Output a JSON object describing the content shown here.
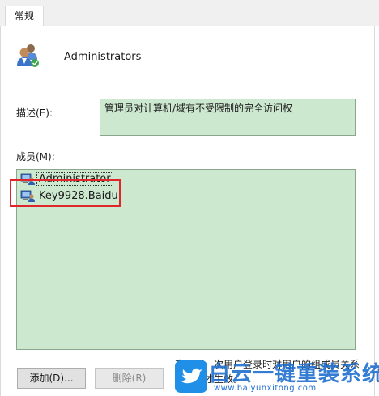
{
  "tabs": [
    {
      "label": "常规",
      "active": true
    }
  ],
  "group": {
    "name": "Administrators",
    "icon": "users-group-icon"
  },
  "description": {
    "label": "描述(E):",
    "value": "管理员对计算机/域有不受限制的完全访问权"
  },
  "members": {
    "label": "成员(M):",
    "items": [
      {
        "name": "Administrator",
        "icon": "user-icon"
      },
      {
        "name": "Key9928.Baidu",
        "icon": "user-icon"
      }
    ]
  },
  "buttons": {
    "add_label": "添加(D)...",
    "remove_label": "删除(R)"
  },
  "note": "直到下一次用户登录时对用户的组成员关系的更改才生效。",
  "watermark": {
    "title": "白云一键重装系统",
    "url": "www.baiyunxitong.com"
  },
  "colors": {
    "field_bg": "#cce8cf",
    "highlight": "#e0262b",
    "watermark": "#1f6fcf"
  }
}
